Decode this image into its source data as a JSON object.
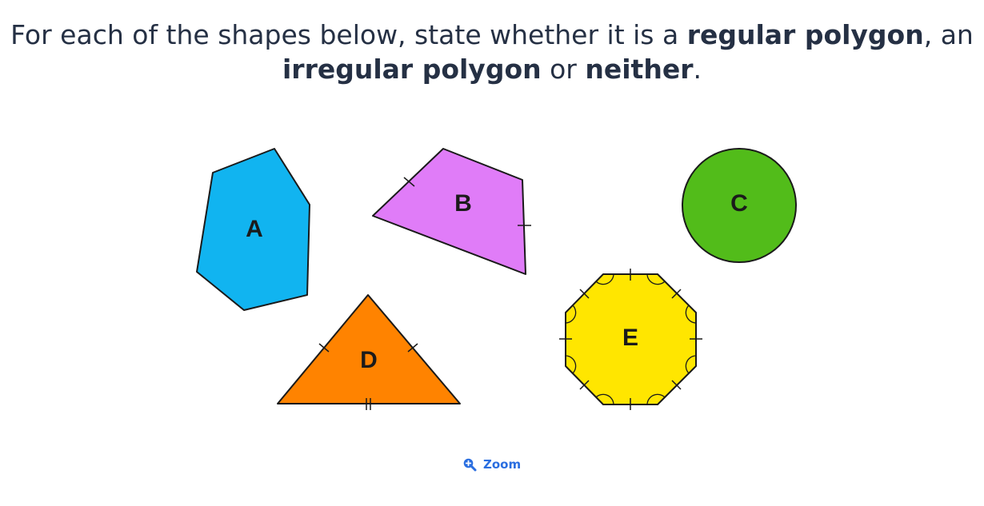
{
  "question": {
    "part1": "For each of the shapes below, state whether it is a ",
    "bold1": "regular polygon",
    "part2": ", an ",
    "bold2": "irregular polygon",
    "part3": " or ",
    "bold3": "neither",
    "part4": "."
  },
  "shapes": {
    "a": {
      "label": "A",
      "fill": "#11b4f0"
    },
    "b": {
      "label": "B",
      "fill": "#e07cf8"
    },
    "c": {
      "label": "C",
      "fill": "#52bc1a"
    },
    "d": {
      "label": "D",
      "fill": "#ff8300"
    },
    "e": {
      "label": "E",
      "fill": "#ffe600"
    }
  },
  "zoom": {
    "label": "Zoom",
    "icon": "zoom-in-icon",
    "color": "#2a6ee0"
  }
}
